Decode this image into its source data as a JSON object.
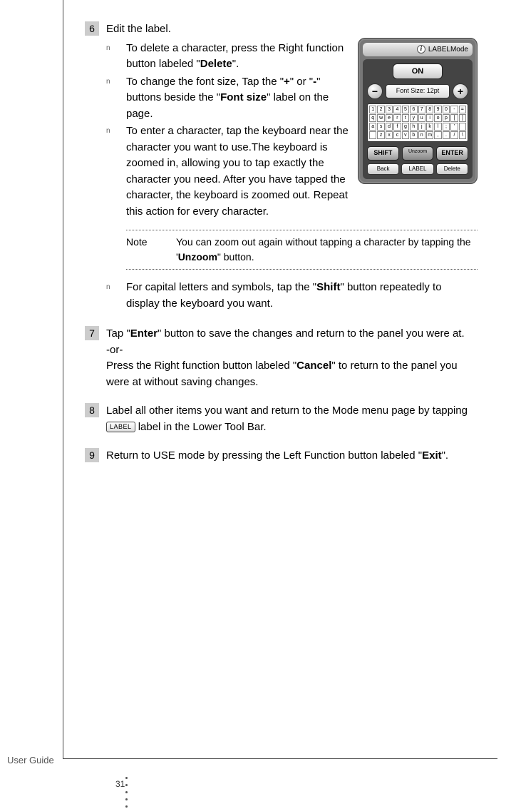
{
  "steps": {
    "6": {
      "num": "6",
      "title": "Edit the label.",
      "bullets": [
        {
          "pre": "To delete a character, press the Right function button labeled \"",
          "bold1": "Delete",
          "post1": "\"."
        },
        {
          "pre": "To change the font size, Tap the \"",
          "bold1": "+",
          "mid1": "\" or \"",
          "bold2": "-",
          "mid2": "\" buttons beside the \"",
          "bold3": "Font size",
          "post": "\" label on the page."
        },
        {
          "text": "To enter a character, tap the keyboard near the character you want to use.The keyboard is zoomed in, allowing you to tap exactly the character you need. After you have tapped the character, the keyboard is zoomed out. Repeat this action for every character."
        }
      ],
      "note": {
        "label": "Note",
        "pre": "You can zoom out again without tapping a character by tapping the '",
        "bold": "Unzoom",
        "post": "\" button."
      },
      "bullet4": {
        "pre": "For capital letters and symbols, tap the \"",
        "bold": "Shift",
        "post": "\" button repeatedly to display the keyboard you want."
      }
    },
    "7": {
      "num": "7",
      "pre": "Tap \"",
      "bold1": "Enter",
      "mid1": "\" button to save the changes and return to the panel you were at.",
      "or": "-or-",
      "pre2": "Press the Right function button labeled \"",
      "bold2": "Cancel",
      "post2": "\" to return to the panel you were at without saving changes."
    },
    "8": {
      "num": "8",
      "pre": "Label all other items you want and return to the Mode menu page by tapping ",
      "btn": "LABEL",
      "post": " label in the Lower Tool Bar."
    },
    "9": {
      "num": "9",
      "pre": "Return to USE mode by pressing the Left Function button labeled \"",
      "bold": "Exit",
      "post": "\"."
    }
  },
  "device": {
    "header": "LABELMode",
    "on": "ON",
    "fontsize": "Font Size:  12pt",
    "minus": "−",
    "plus": "+",
    "kb_rows": [
      [
        "1",
        "2",
        "3",
        "4",
        "5",
        "6",
        "7",
        "8",
        "9",
        "0",
        "-",
        "="
      ],
      [
        "q",
        "w",
        "e",
        "r",
        "t",
        "y",
        "u",
        "i",
        "o",
        "p",
        "[",
        "]"
      ],
      [
        "a",
        "s",
        "d",
        "f",
        "g",
        "h",
        "j",
        "k",
        "l",
        ";",
        "'",
        " "
      ],
      [
        " ",
        "z",
        "x",
        "c",
        "v",
        "b",
        "n",
        "m",
        ",",
        ".",
        "/",
        "\\"
      ]
    ],
    "shift": "SHIFT",
    "unzoom": "Unzoom",
    "enter": "ENTER",
    "back": "Back",
    "label": "LABEL",
    "delete": "Delete"
  },
  "footer": {
    "guide": "User Guide",
    "page": "31"
  },
  "bullet_mark": "n"
}
